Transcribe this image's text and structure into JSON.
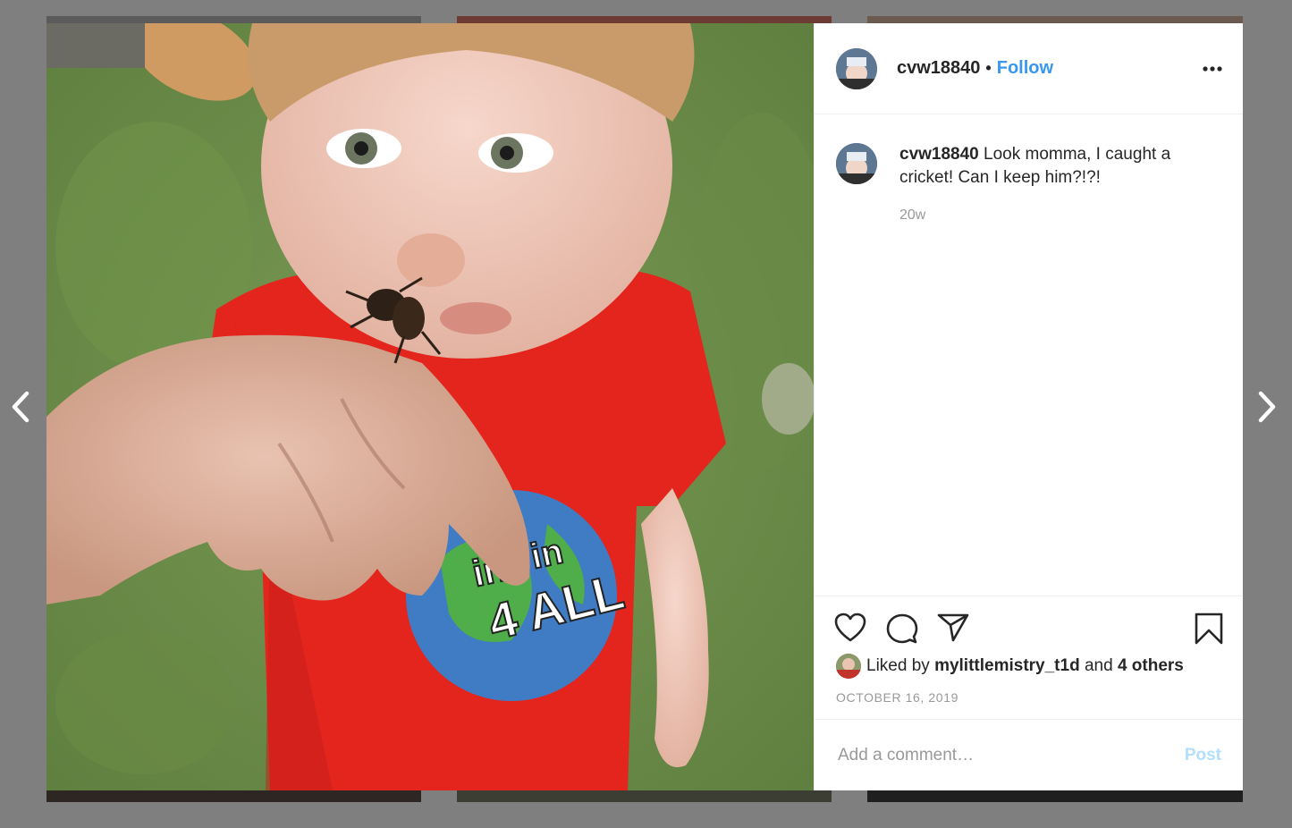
{
  "post": {
    "username": "cvw18840",
    "follow_label": "Follow",
    "separator": "•",
    "caption_text": "Look momma, I caught a cricket! Can I keep him?!?!",
    "age": "20w",
    "likes": {
      "prefix": "Liked by",
      "user": "mylittlemistry_t1d",
      "joiner": "and",
      "others": "4 others"
    },
    "date": "OCTOBER 16, 2019"
  },
  "comment": {
    "placeholder": "Add a comment…",
    "post_label": "Post"
  },
  "photo": {
    "shirt_text_1": "in",
    "shirt_text_2": "4 ALL",
    "shirt_text_3": "ine"
  },
  "colors": {
    "link": "#3897f0",
    "post_disabled": "#b2dffc",
    "backdrop": "#7f7f7f"
  },
  "icons": {
    "nav_prev": "chevron-left-icon",
    "nav_next": "chevron-right-icon",
    "more": "more-horizontal-icon",
    "like": "heart-icon",
    "comment": "comment-bubble-icon",
    "share": "paper-plane-icon",
    "save": "bookmark-icon"
  }
}
